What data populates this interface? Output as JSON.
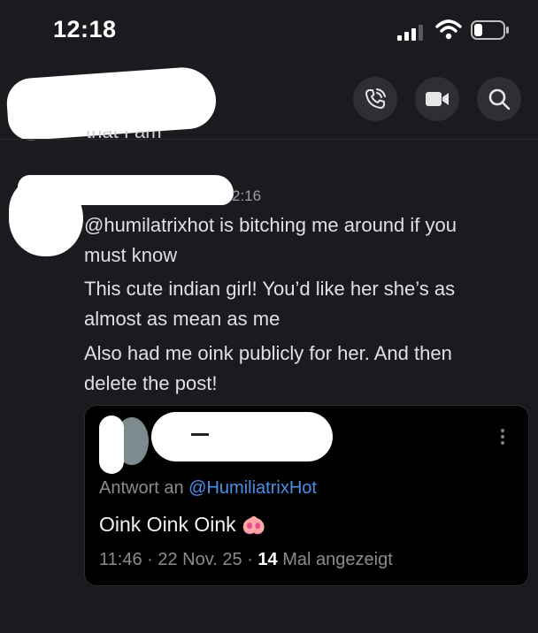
{
  "status_bar": {
    "time": "12:18"
  },
  "header": {
    "clipped_previous_text": "that I am"
  },
  "message": {
    "time_partial": "2:16",
    "lines": [
      "@humilatrixhot is bitching me around if you",
      "must know",
      "This cute indian girl! You’d like her she’s as",
      "almost as mean as me",
      "Also had me oink publicly for her. And then",
      "delete the post!"
    ]
  },
  "embed": {
    "reply_prefix": "Antwort an",
    "reply_mention": "@HumiliatrixHot",
    "text": "Oink Oink Oink",
    "emoji": "🐽",
    "time": "11:46",
    "date": "22 Nov. 25",
    "views_count": "14",
    "views_label": "Mal angezeigt"
  },
  "icons": {
    "back": "chevron-left-icon",
    "call": "phone-call-icon",
    "video": "video-camera-icon",
    "search": "search-icon",
    "menu": "vertical-dots-icon"
  },
  "colors": {
    "background": "#1a1b1f",
    "mention": "#4a8fe8",
    "card": "#000000"
  }
}
